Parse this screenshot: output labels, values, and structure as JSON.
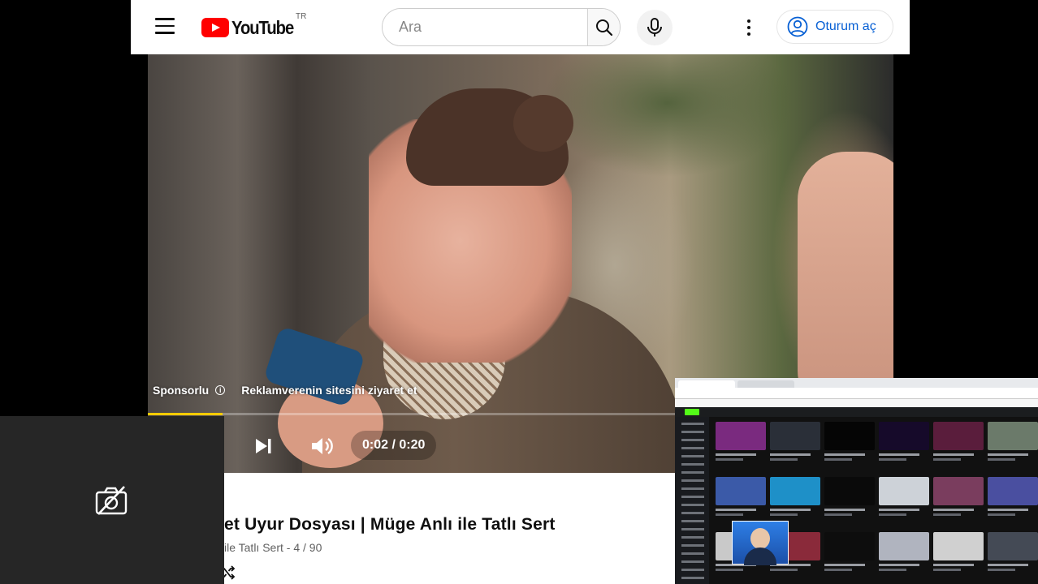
{
  "header": {
    "logo_text": "YouTube",
    "region_code": "TR",
    "search_placeholder": "Ara",
    "signin_label": "Oturum aç"
  },
  "player": {
    "ad_sponsored_label": "Sponsorlu",
    "ad_visit_label": "Reklamverenin sitesini ziyaret et",
    "time_display": "0:02 / 0:20",
    "progress_fraction": 0.1,
    "progress_color": "#ffcc00"
  },
  "video": {
    "title": "et Uyur Dosyası | Müge Anlı ile Tatlı Sert",
    "playlist_info": "ile Tatlı Sert - 4 / 90"
  },
  "camera_overlay": {
    "icon": "camera-off-icon"
  },
  "screen_share": {
    "thumbnail_colors": [
      "#7a2a7f",
      "#2a2f38",
      "#050505",
      "#160a2a",
      "#5a1d3c",
      "#6b7a6a",
      "#3b5aa8",
      "#1e90c8",
      "#0a0a0a",
      "#cdd2d8",
      "#7a3d5e",
      "#4a4fa0",
      "#c9c9c9",
      "#8a2a3a",
      "#0d0d0d",
      "#b0b4bf",
      "#d0d0d0",
      "#444a55"
    ]
  },
  "colors": {
    "brand_red": "#ff0000",
    "link_blue": "#065fd4",
    "kick_green": "#53fc18"
  }
}
